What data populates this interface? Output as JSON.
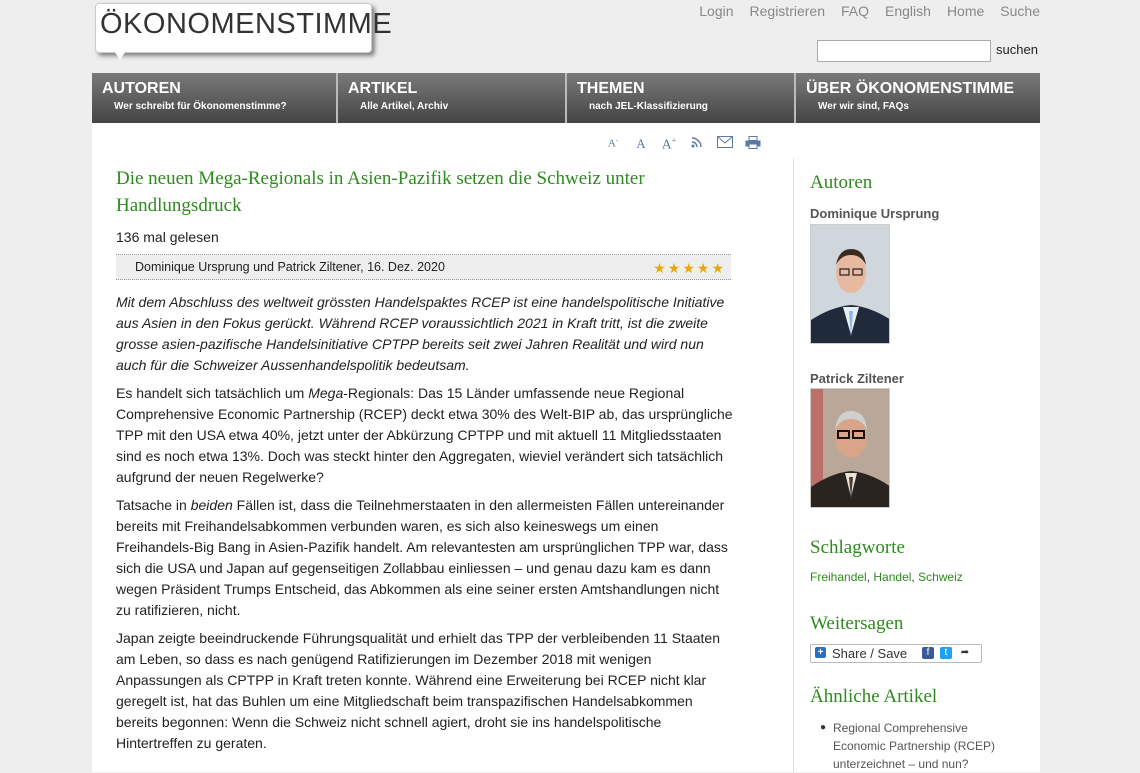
{
  "logo": {
    "text": "ÖKONOMENSTIMME"
  },
  "top_links": [
    "Login",
    "Registrieren",
    "FAQ",
    "English",
    "Home",
    "Suche"
  ],
  "search": {
    "value": "",
    "button": "suchen"
  },
  "nav": [
    {
      "title": "AUTOREN",
      "sub": "Wer schreibt für Ökonomenstimme?"
    },
    {
      "title": "ARTIKEL",
      "sub": "Alle Artikel, Archiv"
    },
    {
      "title": "THEMEN",
      "sub": "nach JEL-Klassifizierung"
    },
    {
      "title": "ÜBER ÖKONOMENSTIMME",
      "sub": "Wer wir sind, FAQs"
    }
  ],
  "toolbar_icons": [
    "font-decrease-icon",
    "font-reset-icon",
    "font-increase-icon",
    "rss-icon",
    "email-icon",
    "print-icon"
  ],
  "article": {
    "title": "Die neuen Mega-Regionals in Asien-Pazifik setzen die Schweiz unter Handlungsdruck",
    "reads": "136 mal gelesen",
    "authors": "Dominique Ursprung und Patrick Ziltener",
    "date": "16. Dez. 2020",
    "rating_stars": 5,
    "lead": "Mit dem Abschluss des weltweit grössten Handelspaktes RCEP ist eine handelspolitische Initiative aus Asien in den Fokus gerückt. Während RCEP voraussichtlich 2021 in Kraft tritt, ist die zweite grosse asien-pazifische Handelsinitiative CPTPP bereits seit zwei Jahren Realität und wird nun auch für die Schweizer Aussenhandelspolitik bedeutsam.",
    "p1_pre": "Es handelt sich tatsächlich um ",
    "p1_em": "Mega",
    "p1_post": "-Regionals: Das 15 Länder umfassende neue Regional Comprehensive Economic Partnership (RCEP) deckt etwa 30% des Welt-BIP ab, das ursprüngliche TPP mit den USA etwa 40%, jetzt unter der Abkürzung CPTPP und mit aktuell 11 Mitgliedsstaaten sind es noch etwa 13%. Doch was steckt hinter den Aggregaten, wieviel verändert sich tatsächlich aufgrund der neuen Regelwerke?",
    "p2_pre": "Tatsache in ",
    "p2_em": "beiden",
    "p2_post": " Fällen ist, dass die Teilnehmerstaaten in den allermeisten Fällen untereinander bereits mit Freihandelsabkommen verbunden waren, es sich also keineswegs um einen Freihandels-Big Bang in Asien-Pazifik handelt. Am relevantesten am ursprünglichen TPP war, dass sich die USA und Japan auf gegenseitigen Zollabbau einliessen – und genau dazu kam es dann wegen Präsident Trumps Entscheid, das Abkommen als eine seiner ersten Amtshandlungen nicht zu ratifizieren, nicht.",
    "p3": "Japan zeigte beeindruckende Führungsqualität und erhielt das TPP der verbleibenden 11 Staaten am Leben, so dass es nach genügend Ratifizierungen im Dezember 2018 mit wenigen Anpassungen als CPTPP in Kraft treten konnte. Während eine Erweiterung bei RCEP nicht klar geregelt ist, hat das Buhlen um eine Mitgliedschaft beim transpazifischen Handelsabkommen bereits begonnen: Wenn die Schweiz nicht schnell agiert, droht sie ins handelspolitische Hintertreffen zu geraten."
  },
  "sidebar": {
    "authors_heading": "Autoren",
    "author1": "Dominique Ursprung",
    "author2": "Patrick Ziltener",
    "tags_heading": "Schlagworte",
    "tags": [
      "Freihandel",
      "Handel",
      "Schweiz"
    ],
    "share_heading": "Weitersagen",
    "share_label": "Share / Save",
    "related_heading": "Ähnliche Artikel",
    "related": [
      "Regional Comprehensive Economic Partnership (RCEP) unterzeichnet – und nun?"
    ]
  },
  "colors": {
    "accent_green": "#2e8b1e",
    "nav_dark": "#444444",
    "star_gold": "#e8a80c"
  }
}
